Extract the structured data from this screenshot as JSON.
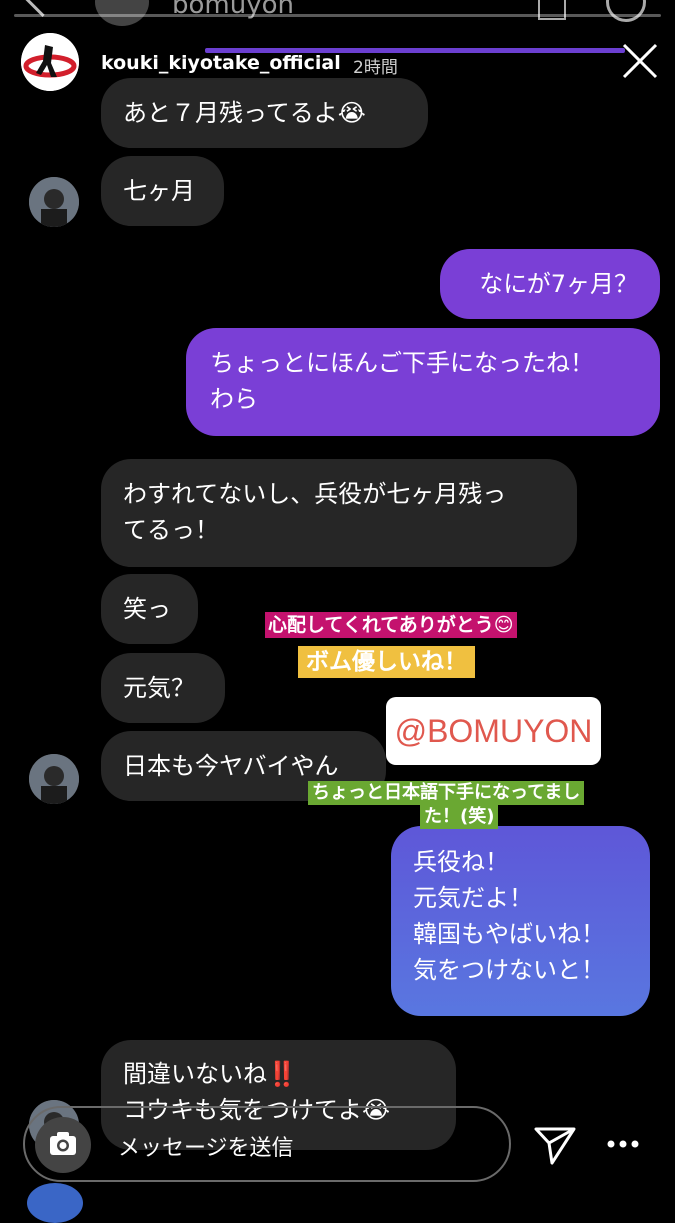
{
  "ghost_header": {
    "title": "bomuyon"
  },
  "story": {
    "username": "kouki_kiyotake_official",
    "time": "2時間",
    "progress": 0.0
  },
  "messages": [
    {
      "side": "in",
      "text": "あと７月残ってるよ😭"
    },
    {
      "side": "in",
      "text": "七ヶ月"
    },
    {
      "side": "out",
      "text": "なにが7ヶ月？"
    },
    {
      "side": "out",
      "text": "ちょっとにほんご下手になったね！\nわら"
    },
    {
      "side": "in",
      "text": "わすれてないし、兵役が七ヶ月残っ\nてるっ！"
    },
    {
      "side": "in",
      "text": "笑っ"
    },
    {
      "side": "in",
      "text": "元気？"
    },
    {
      "side": "in",
      "text": "日本も今ヤバイやん"
    },
    {
      "side": "out",
      "text": "兵役ね！\n元気だよ！\n韓国もやばいね！\n気をつけないと！"
    },
    {
      "side": "in",
      "text": "間違いないね‼️\nコウキも気をつけてよ😭"
    }
  ],
  "stickers": {
    "pink": "心配してくれてありがとう😊",
    "yellow": "ボム優しいね！",
    "mention": "@BOMUYON",
    "green1": "ちょっと日本語下手になってまし",
    "green2": "た！(笑)"
  },
  "message_bar": {
    "placeholder": "メッセージを送信"
  },
  "colors": {
    "purple": "#7a3fd6",
    "blue": "#5a6be0",
    "incoming": "#262626",
    "pink_bg": "#c4126e",
    "yellow_bg": "#f0c040",
    "green_bg": "#6aa832"
  }
}
